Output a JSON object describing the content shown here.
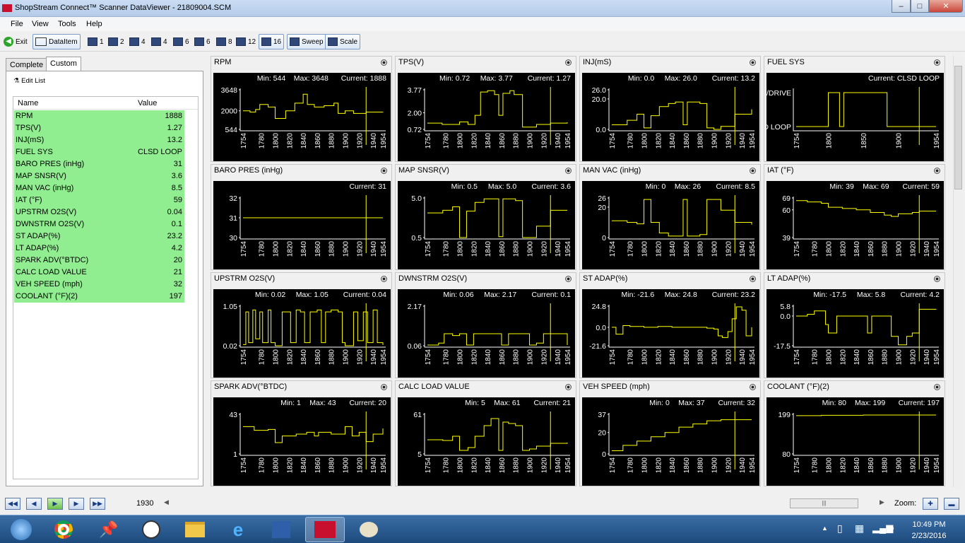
{
  "window": {
    "title": "ShopStream Connect™ Scanner DataViewer - 21809004.SCM"
  },
  "menu": [
    "File",
    "View",
    "Tools",
    "Help"
  ],
  "toolbar": {
    "exit": "Exit",
    "dataitem": "DataItem",
    "layouts": [
      "1",
      "2",
      "4",
      "4",
      "6",
      "6",
      "8",
      "12",
      "16"
    ],
    "sweep": "Sweep",
    "scale": "Scale"
  },
  "left": {
    "tabs": [
      "Complete",
      "Custom"
    ],
    "edit_list": "Edit List",
    "col_name": "Name",
    "col_value": "Value",
    "rows": [
      {
        "name": "RPM",
        "value": "1888"
      },
      {
        "name": "TPS(V)",
        "value": "1.27"
      },
      {
        "name": "INJ(mS)",
        "value": "13.2"
      },
      {
        "name": "FUEL SYS",
        "value": "CLSD LOOP"
      },
      {
        "name": "BARO PRES (inHg)",
        "value": "31"
      },
      {
        "name": "MAP SNSR(V)",
        "value": "3.6"
      },
      {
        "name": "MAN VAC (inHg)",
        "value": "8.5"
      },
      {
        "name": "IAT (°F)",
        "value": "59"
      },
      {
        "name": "UPSTRM O2S(V)",
        "value": "0.04"
      },
      {
        "name": "DWNSTRM O2S(V)",
        "value": "0.1"
      },
      {
        "name": "ST ADAP(%)",
        "value": "23.2"
      },
      {
        "name": "LT ADAP(%)",
        "value": "4.2"
      },
      {
        "name": "SPARK ADV(°BTDC)",
        "value": "20"
      },
      {
        "name": "CALC LOAD VALUE",
        "value": "21"
      },
      {
        "name": "VEH SPEED (mph)",
        "value": "32"
      },
      {
        "name": "COOLANT (°F)(2)",
        "value": "197"
      }
    ]
  },
  "colors": {
    "trace": "#ffff00",
    "plot_bg": "#000000",
    "row_bg": "#90ee90"
  },
  "chart_data": [
    {
      "type": "line",
      "title": "RPM",
      "stats": {
        "min": "Min: 544",
        "max": "Max: 3648",
        "current": "Current: 1888"
      },
      "yticks": [
        "3648",
        "2000",
        "544"
      ],
      "ylim": [
        544,
        3648
      ],
      "xticks": [
        "1754",
        "1780",
        "1800",
        "1820",
        "1840",
        "1860",
        "1880",
        "1900",
        "1920",
        "1940",
        "1954"
      ],
      "xlim": [
        1754,
        1954
      ],
      "cursor": 1930,
      "x": [
        1754,
        1764,
        1772,
        1778,
        1790,
        1800,
        1806,
        1815,
        1828,
        1840,
        1846,
        1856,
        1870,
        1884,
        1890,
        1900,
        1912,
        1930,
        1954
      ],
      "y": [
        2000,
        1900,
        2100,
        2500,
        2300,
        1400,
        1400,
        2000,
        2600,
        3300,
        2500,
        2300,
        2400,
        2600,
        1800,
        2000,
        1800,
        1900,
        1888
      ]
    },
    {
      "type": "line",
      "title": "TPS(V)",
      "stats": {
        "min": "Min: 0.72",
        "max": "Max: 3.77",
        "current": "Current: 1.27"
      },
      "yticks": [
        "3.77",
        "2.00",
        "0.72"
      ],
      "ylim": [
        0.72,
        3.77
      ],
      "xticks": [
        "1754",
        "1780",
        "1800",
        "1820",
        "1840",
        "1860",
        "1880",
        "1900",
        "1920",
        "1940",
        "1954"
      ],
      "xlim": [
        1754,
        1954
      ],
      "cursor": 1930,
      "x": [
        1754,
        1775,
        1800,
        1812,
        1822,
        1830,
        1840,
        1850,
        1856,
        1862,
        1872,
        1878,
        1890,
        1900,
        1910,
        1930,
        1954
      ],
      "y": [
        1.2,
        1.1,
        1.3,
        1.1,
        1.8,
        3.6,
        3.7,
        3.4,
        1.8,
        3.5,
        3.7,
        3.4,
        0.9,
        0.9,
        1.1,
        1.2,
        1.27
      ]
    },
    {
      "type": "line",
      "title": "INJ(mS)",
      "stats": {
        "min": "Min: 0.0",
        "max": "Max: 26.0",
        "current": "Current: 13.2"
      },
      "yticks": [
        "26.0",
        "20.0",
        "0.0"
      ],
      "ylim": [
        0,
        26
      ],
      "xticks": [
        "1754",
        "1780",
        "1800",
        "1820",
        "1840",
        "1860",
        "1880",
        "1900",
        "1920",
        "1940",
        "1954"
      ],
      "xlim": [
        1754,
        1954
      ],
      "cursor": 1930,
      "x": [
        1754,
        1776,
        1790,
        1800,
        1810,
        1822,
        1835,
        1845,
        1856,
        1862,
        1870,
        1880,
        1890,
        1900,
        1910,
        1930,
        1954
      ],
      "y": [
        3,
        6,
        10,
        1,
        9,
        15,
        17,
        18,
        3,
        18,
        18,
        17,
        1,
        0,
        2,
        10,
        13.2
      ]
    },
    {
      "type": "line",
      "title": "FUEL SYS",
      "stats": {
        "current": "Current: CLSD LOOP"
      },
      "ycats": [
        "OL/DRIVE",
        "CLSD LOOP"
      ],
      "xticks": [
        "1754",
        "1800",
        "1850",
        "1900",
        "1954"
      ],
      "xlim": [
        1754,
        1954
      ],
      "cursor": 1930,
      "x": [
        1754,
        1798,
        1800,
        1812,
        1816,
        1820,
        1822,
        1880,
        1884,
        1954
      ],
      "y": [
        0,
        0,
        1,
        1,
        0,
        0,
        1,
        1,
        0,
        0
      ]
    },
    {
      "type": "line",
      "title": "BARO PRES (inHg)",
      "stats": {
        "current": "Current: 31"
      },
      "yticks": [
        "32",
        "31",
        "30"
      ],
      "ylim": [
        30,
        32
      ],
      "xticks": [
        "1754",
        "1780",
        "1800",
        "1820",
        "1840",
        "1860",
        "1880",
        "1900",
        "1920",
        "1940",
        "1954"
      ],
      "xlim": [
        1754,
        1954
      ],
      "cursor": 1930,
      "x": [
        1754,
        1954
      ],
      "y": [
        31,
        31
      ]
    },
    {
      "type": "line",
      "title": "MAP SNSR(V)",
      "stats": {
        "min": "Min: 0.5",
        "max": "Max: 5.0",
        "current": "Current: 3.6"
      },
      "yticks": [
        "5.0",
        "0.5"
      ],
      "ylim": [
        0.5,
        5
      ],
      "xticks": [
        "1754",
        "1780",
        "1800",
        "1820",
        "1840",
        "1860",
        "1880",
        "1900",
        "1920",
        "1940",
        "1954"
      ],
      "xlim": [
        1754,
        1954
      ],
      "cursor": 1930,
      "x": [
        1754,
        1776,
        1790,
        1800,
        1810,
        1822,
        1835,
        1845,
        1856,
        1862,
        1870,
        1880,
        1890,
        1900,
        1910,
        1930,
        1954
      ],
      "y": [
        3.3,
        3.6,
        4.0,
        0.5,
        3.5,
        4.5,
        4.9,
        4.9,
        0.6,
        4.9,
        4.9,
        4.7,
        0.5,
        0.5,
        1.8,
        3.6,
        3.6
      ]
    },
    {
      "type": "line",
      "title": "MAN VAC (inHg)",
      "stats": {
        "min": "Min: 0",
        "max": "Max: 26",
        "current": "Current: 8.5"
      },
      "yticks": [
        "26",
        "20",
        "0"
      ],
      "ylim": [
        0,
        26
      ],
      "xticks": [
        "1754",
        "1780",
        "1800",
        "1820",
        "1840",
        "1860",
        "1880",
        "1900",
        "1920",
        "1940",
        "1954"
      ],
      "xlim": [
        1754,
        1954
      ],
      "cursor": 1930,
      "x": [
        1754,
        1776,
        1790,
        1800,
        1810,
        1822,
        1835,
        1845,
        1856,
        1862,
        1870,
        1880,
        1890,
        1900,
        1910,
        1930,
        1954
      ],
      "y": [
        11,
        10,
        9,
        25,
        10,
        3,
        1,
        1,
        25,
        1,
        1,
        2,
        25,
        25,
        18,
        10,
        8.5
      ]
    },
    {
      "type": "line",
      "title": "IAT (°F)",
      "stats": {
        "min": "Min: 39",
        "max": "Max: 69",
        "current": "Current: 59"
      },
      "yticks": [
        "69",
        "60",
        "39"
      ],
      "ylim": [
        39,
        69
      ],
      "xticks": [
        "1754",
        "1780",
        "1800",
        "1820",
        "1840",
        "1860",
        "1880",
        "1900",
        "1920",
        "1940",
        "1954"
      ],
      "xlim": [
        1754,
        1954
      ],
      "cursor": 1930,
      "x": [
        1754,
        1770,
        1790,
        1800,
        1820,
        1840,
        1860,
        1880,
        1890,
        1900,
        1920,
        1930,
        1954
      ],
      "y": [
        67,
        66,
        65,
        62,
        61,
        60,
        58,
        56,
        55,
        57,
        58,
        59,
        59
      ]
    },
    {
      "type": "line",
      "title": "UPSTRM O2S(V)",
      "stats": {
        "min": "Min: 0.02",
        "max": "Max: 1.05",
        "current": "Current: 0.04"
      },
      "yticks": [
        "1.05",
        "0.02"
      ],
      "ylim": [
        0.02,
        1.05
      ],
      "xticks": [
        "1754",
        "1780",
        "1800",
        "1820",
        "1840",
        "1860",
        "1880",
        "1900",
        "1920",
        "1940",
        "1954"
      ],
      "xlim": [
        1754,
        1954
      ],
      "cursor": 1930,
      "x": [
        1754,
        1758,
        1762,
        1768,
        1772,
        1778,
        1782,
        1790,
        1794,
        1800,
        1810,
        1818,
        1822,
        1830,
        1836,
        1842,
        1850,
        1860,
        1866,
        1872,
        1880,
        1890,
        1896,
        1900,
        1912,
        1918,
        1926,
        1932,
        1940,
        1946,
        1954
      ],
      "y": [
        0.05,
        0.9,
        0.1,
        0.95,
        0.2,
        0.9,
        0.1,
        0.95,
        0.1,
        0.02,
        0.9,
        0.9,
        0.1,
        0.95,
        0.9,
        0.1,
        0.9,
        0.95,
        0.1,
        0.9,
        0.95,
        0.9,
        0.1,
        0.02,
        0.9,
        0.15,
        0.9,
        0.1,
        0.95,
        0.1,
        0.04
      ]
    },
    {
      "type": "line",
      "title": "DWNSTRM O2S(V)",
      "stats": {
        "min": "Min: 0.06",
        "max": "Max: 2.17",
        "current": "Current: 0.1"
      },
      "yticks": [
        "2.17",
        "0.06"
      ],
      "ylim": [
        0.06,
        2.17
      ],
      "xticks": [
        "1754",
        "1780",
        "1800",
        "1820",
        "1840",
        "1860",
        "1880",
        "1900",
        "1920",
        "1940",
        "1954"
      ],
      "xlim": [
        1754,
        1954
      ],
      "cursor": 1930,
      "x": [
        1754,
        1770,
        1778,
        1790,
        1800,
        1810,
        1820,
        1830,
        1840,
        1850,
        1860,
        1870,
        1880,
        1890,
        1900,
        1910,
        1920,
        1930,
        1940,
        1954
      ],
      "y": [
        0.1,
        0.2,
        0.7,
        0.6,
        0.7,
        0.1,
        0.7,
        0.7,
        0.7,
        0.7,
        0.1,
        0.7,
        0.7,
        0.7,
        0.1,
        0.2,
        0.7,
        0.7,
        0.7,
        0.1
      ]
    },
    {
      "type": "line",
      "title": "ST ADAP(%)",
      "stats": {
        "min": "Min: -21.6",
        "max": "Max: 24.8",
        "current": "Current: 23.2"
      },
      "yticks": [
        "24.8",
        "0.0",
        "-21.6"
      ],
      "ylim": [
        -21.6,
        24.8
      ],
      "xticks": [
        "1754",
        "1780",
        "1800",
        "1820",
        "1840",
        "1860",
        "1880",
        "1900",
        "1920",
        "1940",
        "1954"
      ],
      "xlim": [
        1754,
        1954
      ],
      "cursor": 1930,
      "x": [
        1754,
        1760,
        1770,
        1780,
        1800,
        1820,
        1840,
        1860,
        1880,
        1890,
        1900,
        1906,
        1912,
        1920,
        1926,
        1932,
        1940,
        1946,
        1954
      ],
      "y": [
        0,
        -8,
        2,
        1,
        0,
        1,
        0,
        0,
        0,
        -1,
        -2,
        -10,
        -12,
        -5,
        10,
        24,
        20,
        -10,
        0
      ]
    },
    {
      "type": "line",
      "title": "LT ADAP(%)",
      "stats": {
        "min": "Min: -17.5",
        "max": "Max: 5.8",
        "current": "Current: 4.2"
      },
      "yticks": [
        "5.8",
        "0.0",
        "-17.5"
      ],
      "ylim": [
        -17.5,
        5.8
      ],
      "xticks": [
        "1754",
        "1780",
        "1800",
        "1820",
        "1840",
        "1860",
        "1880",
        "1900",
        "1920",
        "1940",
        "1954"
      ],
      "xlim": [
        1754,
        1954
      ],
      "cursor": 1930,
      "x": [
        1754,
        1770,
        1780,
        1790,
        1796,
        1800,
        1812,
        1820,
        1850,
        1856,
        1862,
        1880,
        1890,
        1900,
        1912,
        1920,
        1930,
        1940,
        1954
      ],
      "y": [
        0,
        1,
        3,
        3,
        -5,
        -10,
        0,
        0,
        0,
        -10,
        0,
        0,
        -12,
        -17,
        -12,
        -10,
        4,
        4,
        4.2
      ]
    },
    {
      "type": "line",
      "title": "SPARK ADV(°BTDC)",
      "stats": {
        "min": "Min: 1",
        "max": "Max: 43",
        "current": "Current: 20"
      },
      "yticks": [
        "43",
        "1"
      ],
      "ylim": [
        1,
        43
      ],
      "xticks": [
        "1754",
        "1780",
        "1800",
        "1820",
        "1840",
        "1860",
        "1880",
        "1900",
        "1920",
        "1940",
        "1954"
      ],
      "xlim": [
        1754,
        1954
      ],
      "cursor": 1930,
      "x": [
        1754,
        1770,
        1790,
        1800,
        1810,
        1830,
        1845,
        1856,
        1862,
        1880,
        1890,
        1900,
        1910,
        1920,
        1930,
        1940,
        1954
      ],
      "y": [
        30,
        26,
        27,
        13,
        20,
        22,
        24,
        20,
        24,
        22,
        22,
        30,
        20,
        24,
        14,
        22,
        28
      ]
    },
    {
      "type": "line",
      "title": "CALC LOAD VALUE",
      "stats": {
        "min": "Min: 5",
        "max": "Max: 61",
        "current": "Current: 21"
      },
      "yticks": [
        "61",
        "5"
      ],
      "ylim": [
        5,
        61
      ],
      "xticks": [
        "1754",
        "1780",
        "1800",
        "1820",
        "1840",
        "1860",
        "1880",
        "1900",
        "1920",
        "1940",
        "1954"
      ],
      "xlim": [
        1754,
        1954
      ],
      "cursor": 1930,
      "x": [
        1754,
        1776,
        1790,
        1800,
        1812,
        1822,
        1835,
        1845,
        1856,
        1862,
        1870,
        1880,
        1890,
        1900,
        1910,
        1930,
        1954
      ],
      "y": [
        25,
        24,
        30,
        10,
        14,
        30,
        45,
        55,
        10,
        50,
        48,
        45,
        10,
        12,
        16,
        20,
        21
      ]
    },
    {
      "type": "line",
      "title": "VEH SPEED (mph)",
      "stats": {
        "min": "Min: 0",
        "max": "Max: 37",
        "current": "Current: 32"
      },
      "yticks": [
        "37",
        "20",
        "0"
      ],
      "ylim": [
        0,
        37
      ],
      "xticks": [
        "1754",
        "1780",
        "1800",
        "1820",
        "1840",
        "1860",
        "1880",
        "1900",
        "1920",
        "1940",
        "1954"
      ],
      "xlim": [
        1754,
        1954
      ],
      "cursor": 1930,
      "x": [
        1754,
        1770,
        1790,
        1810,
        1830,
        1850,
        1870,
        1890,
        1910,
        1930,
        1954
      ],
      "y": [
        3,
        8,
        12,
        16,
        20,
        25,
        28,
        31,
        32,
        32,
        32
      ]
    },
    {
      "type": "line",
      "title": "COOLANT (°F)(2)",
      "stats": {
        "min": "Min: 80",
        "max": "Max: 199",
        "current": "Current: 197"
      },
      "yticks": [
        "199",
        "80"
      ],
      "ylim": [
        80,
        199
      ],
      "xticks": [
        "1754",
        "1780",
        "1800",
        "1820",
        "1840",
        "1860",
        "1880",
        "1900",
        "1920",
        "1940",
        "1954"
      ],
      "xlim": [
        1754,
        1954
      ],
      "cursor": 1930,
      "x": [
        1754,
        1790,
        1850,
        1954
      ],
      "y": [
        195,
        196,
        197,
        197
      ]
    }
  ],
  "bottom": {
    "position": "1930",
    "zoom_label": "Zoom:"
  },
  "taskbar": {
    "time": "10:49 PM",
    "date": "2/23/2016"
  }
}
